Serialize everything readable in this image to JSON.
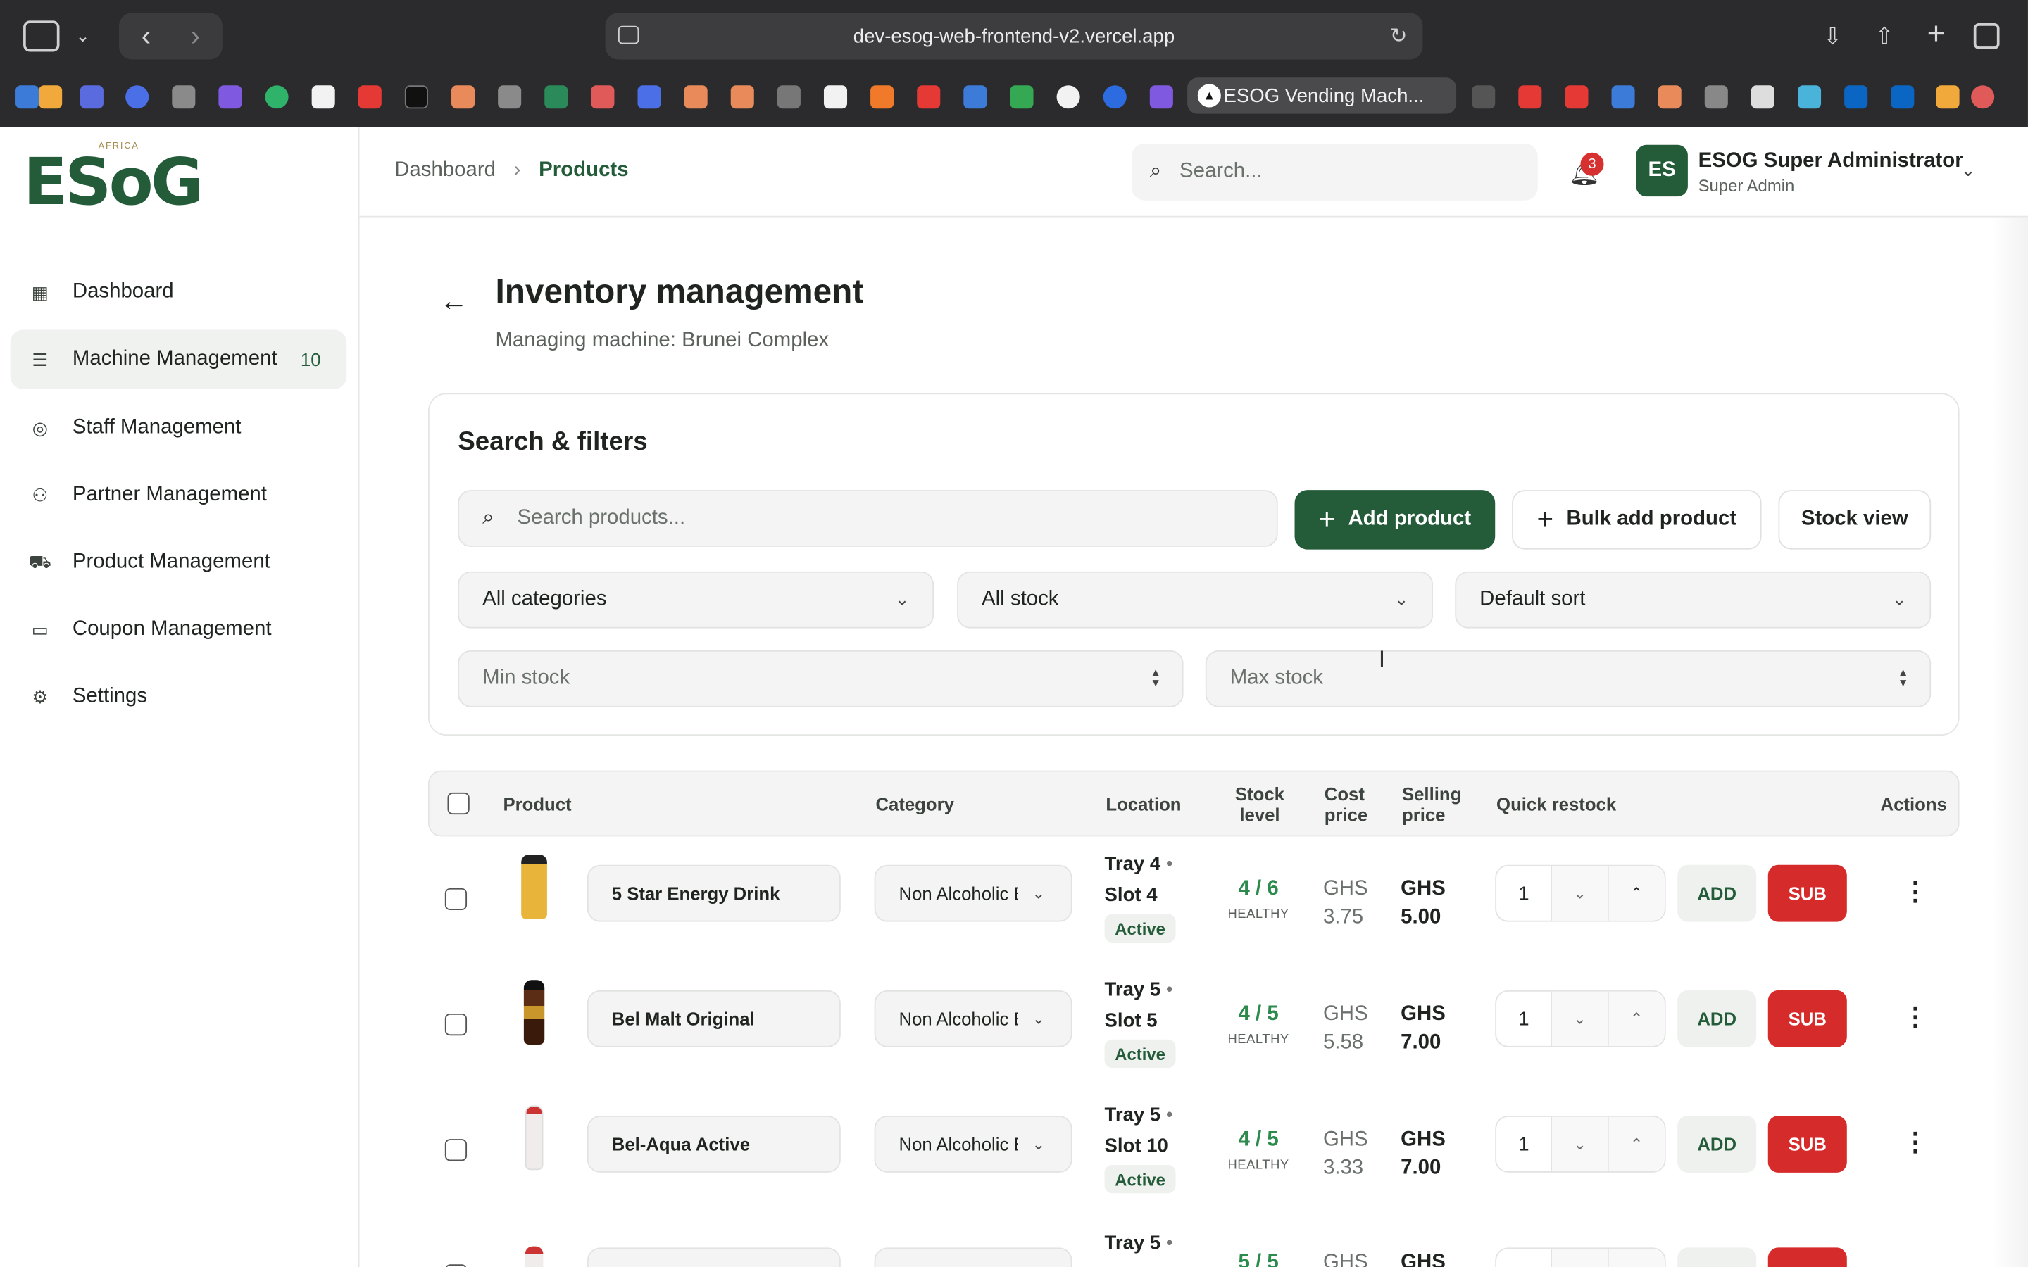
{
  "browser": {
    "url": "dev-esog-web-frontend-v2.vercel.app",
    "active_tab": "ESOG Vending Mach..."
  },
  "sidebar": {
    "logo": "ESoG",
    "logo_sub": "AFRICA",
    "items": [
      {
        "label": "Dashboard",
        "icon": "grid-icon"
      },
      {
        "label": "Machine Management",
        "icon": "sliders-icon",
        "badge": "10",
        "active": true
      },
      {
        "label": "Staff Management",
        "icon": "user-circle-icon"
      },
      {
        "label": "Partner Management",
        "icon": "users-icon"
      },
      {
        "label": "Product Management",
        "icon": "cart-icon"
      },
      {
        "label": "Coupon Management",
        "icon": "ticket-icon"
      },
      {
        "label": "Settings",
        "icon": "gear-icon"
      }
    ]
  },
  "header": {
    "breadcrumb": [
      "Dashboard",
      "Products"
    ],
    "search_placeholder": "Search...",
    "notifications": "3",
    "user": {
      "initials": "ES",
      "name": "ESOG Super Administrator",
      "role": "Super Admin"
    }
  },
  "page": {
    "title": "Inventory management",
    "subtitle": "Managing machine: Brunei Complex"
  },
  "filters": {
    "title": "Search & filters",
    "search_placeholder": "Search products...",
    "add_product": "Add product",
    "bulk_add": "Bulk add product",
    "stock_view": "Stock view",
    "category": "All categories",
    "stock": "All stock",
    "sort": "Default sort",
    "min_placeholder": "Min stock",
    "max_placeholder": "Max stock"
  },
  "table": {
    "headers": {
      "product": "Product",
      "category": "Category",
      "location": "Location",
      "stock1": "Stock",
      "stock2": "level",
      "cost1": "Cost",
      "cost2": "price",
      "sell1": "Selling",
      "sell2": "price",
      "restock": "Quick restock",
      "actions": "Actions"
    },
    "add_label": "ADD",
    "sub_label": "SUB",
    "rows": [
      {
        "name": "5 Star Energy Drink",
        "category": "Non Alcoholic Beverages",
        "tray": "Tray 4",
        "slot": "Slot 4",
        "status": "Active",
        "stock": "4 / 6",
        "stock_label": "HEALTHY",
        "cost_cur": "GHS",
        "cost": "3.75",
        "sell_cur": "GHS",
        "sell": "5.00",
        "qty": "1",
        "color": "#e8b53a"
      },
      {
        "name": "Bel Malt Original",
        "category": "Non Alcoholic Beverages",
        "tray": "Tray 5",
        "slot": "Slot 5",
        "status": "Active",
        "stock": "4 / 5",
        "stock_label": "HEALTHY",
        "cost_cur": "GHS",
        "cost": "5.58",
        "sell_cur": "GHS",
        "sell": "7.00",
        "qty": "1",
        "color": "#5a2d14"
      },
      {
        "name": "Bel-Aqua Active",
        "category": "Non Alcoholic Beverages",
        "tray": "Tray 5",
        "slot": "Slot 10",
        "status": "Active",
        "stock": "4 / 5",
        "stock_label": "HEALTHY",
        "cost_cur": "GHS",
        "cost": "3.33",
        "sell_cur": "GHS",
        "sell": "7.00",
        "qty": "1",
        "color": "#e9e3e3"
      },
      {
        "name": "",
        "category": "",
        "tray": "Tray 5",
        "slot": "",
        "status": "",
        "stock": "5 / 5",
        "stock_label": "",
        "cost_cur": "GHS",
        "cost": "",
        "sell_cur": "GHS",
        "sell": "",
        "qty": "",
        "color": "#e9e3e3"
      }
    ]
  }
}
